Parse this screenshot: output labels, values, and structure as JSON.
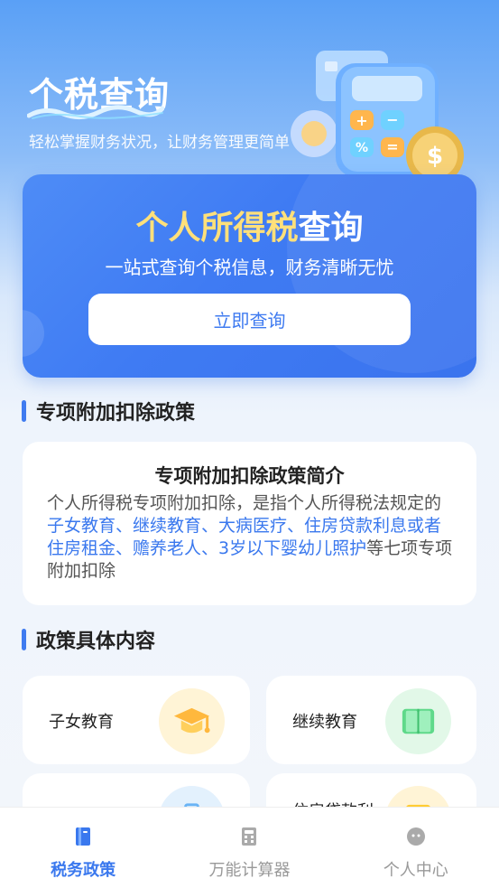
{
  "header": {
    "title": "个税查询",
    "subtitle": "轻松掌握财务状况，让财务管理更简单"
  },
  "hero": {
    "title_highlight": "个人所得税",
    "title_rest": "查询",
    "subtitle": "一站式查询个税信息，财务清晰无忧",
    "button_label": "立即查询"
  },
  "section1": {
    "title": "专项附加扣除政策"
  },
  "intro": {
    "title": "专项附加扣除政策简介",
    "text_before": "个人所得税专项附加扣除，是指个人所得税法规定的",
    "text_highlight": "子女教育、继续教育、大病医疗、住房贷款利息或者住房租金、赡养老人、3岁以下婴幼儿照护",
    "text_after": "等七项专项附加扣除"
  },
  "section2": {
    "title": "政策具体内容"
  },
  "policy_items": [
    {
      "label": "子女教育",
      "icon": "graduation-cap-icon",
      "icon_bg": "#fff4d6"
    },
    {
      "label": "继续教育",
      "icon": "book-icon",
      "icon_bg": "#e2f8e8"
    },
    {
      "label": "",
      "icon": "medical-kit-icon",
      "icon_bg": "#e3f1fd"
    },
    {
      "label": "住房贷款利",
      "icon": "house-icon",
      "icon_bg": "#fff4d6"
    }
  ],
  "tabbar": {
    "tabs": [
      {
        "label": "税务政策",
        "icon": "policy-book-icon",
        "active": true
      },
      {
        "label": "万能计算器",
        "icon": "calculator-icon",
        "active": false
      },
      {
        "label": "个人中心",
        "icon": "user-icon",
        "active": false
      }
    ]
  },
  "colors": {
    "primary": "#3a78ee",
    "highlight_yellow": "#ffe07a",
    "inactive": "#999999"
  }
}
